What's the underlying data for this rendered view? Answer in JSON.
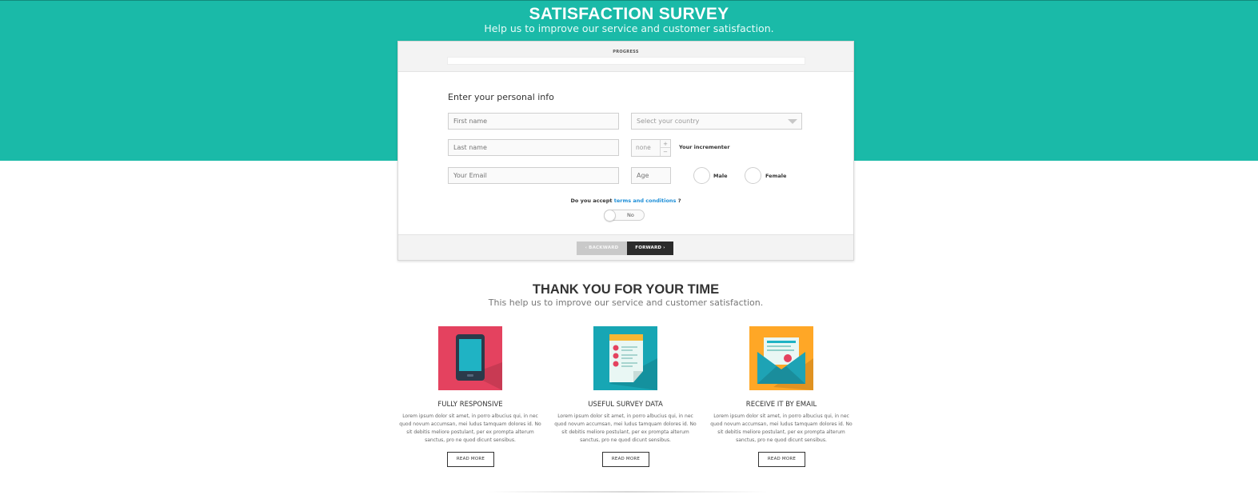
{
  "header": {
    "title": "SATISFACTION SURVEY",
    "subtitle": "Help us to improve our service and customer satisfaction."
  },
  "survey": {
    "progress_label": "PROGRESS",
    "progress_value": 0,
    "section_title": "Enter your personal info",
    "first_name": {
      "value": "",
      "placeholder": "First name"
    },
    "last_name": {
      "value": "",
      "placeholder": "Last name"
    },
    "email": {
      "value": "",
      "placeholder": "Your Email"
    },
    "country": {
      "selected": "Select your country"
    },
    "incrementer": {
      "value": "none",
      "label": "Your incrementer",
      "plus": "+",
      "minus": "−"
    },
    "age": {
      "value": "",
      "placeholder": "Age"
    },
    "gender": {
      "male_label": "Male",
      "female_label": "Female"
    },
    "terms": {
      "prefix": "Do you accept ",
      "link": "terms and conditions",
      "suffix": " ?"
    },
    "toggle_label": "No",
    "backward_label": "‹ BACKWARD",
    "forward_label": "FORWARD ›"
  },
  "thanks": {
    "title": "THANK YOU FOR YOUR TIME",
    "subtitle": "This help us to improve our service and customer satisfaction."
  },
  "features": [
    {
      "icon": "tablet-icon",
      "title": "FULLY RESPONSIVE",
      "text": "Lorem ipsum dolor sit amet, in porro albucius qui, in nec quod novum accumsan, mei ludus tamquam dolores id. No sit debitis meliore postulant, per ex prompta alterum sanctus, pro ne quod dicunt sensibus.",
      "button": "READ MORE"
    },
    {
      "icon": "survey-document-icon",
      "title": "USEFUL SURVEY DATA",
      "text": "Lorem ipsum dolor sit amet, in porro albucius qui, in nec quod novum accumsan, mei ludus tamquam dolores id. No sit debitis meliore postulant, per ex prompta alterum sanctus, pro ne quod dicunt sensibus.",
      "button": "READ MORE"
    },
    {
      "icon": "email-envelope-icon",
      "title": "RECEIVE IT BY EMAIL",
      "text": "Lorem ipsum dolor sit amet, in porro albucius qui, in nec quod novum accumsan, mei ludus tamquam dolores id. No sit debitis meliore postulant, per ex prompta alterum sanctus, pro ne quod dicunt sensibus.",
      "button": "READ MORE"
    }
  ],
  "colors": {
    "accent": "#1abaa8",
    "tablet_bg": "#e4425f",
    "document_bg": "#17a6b4",
    "envelope_bg": "#ffa726",
    "link": "#1e8fd8"
  }
}
